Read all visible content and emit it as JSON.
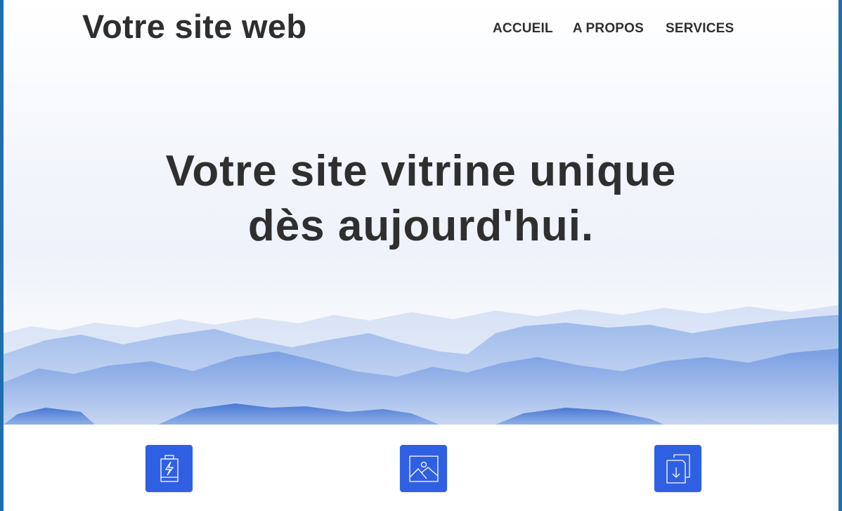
{
  "site": {
    "title": "Votre site web"
  },
  "nav": {
    "items": [
      {
        "label": "ACCUEIL"
      },
      {
        "label": "A PROPOS"
      },
      {
        "label": "SERVICES"
      }
    ]
  },
  "hero": {
    "headline_line1": "Votre site vitrine unique",
    "headline_line2": "dès aujourd'hui."
  },
  "features": [
    {
      "icon": "battery-charging-icon"
    },
    {
      "icon": "image-icon"
    },
    {
      "icon": "document-download-icon"
    }
  ],
  "colors": {
    "frame_border": "#1f6fae",
    "text": "#2e2e2e",
    "accent": "#2f5fe3",
    "mountain_light": "#b9cdf0",
    "mountain_dark": "#4f7fd6"
  }
}
